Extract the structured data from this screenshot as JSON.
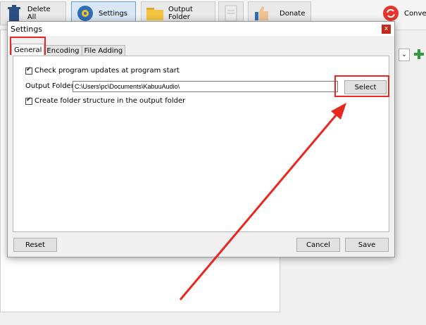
{
  "toolbar": {
    "delete_all_label": "Delete All",
    "settings_label": "Settings",
    "output_folder_label": "Output Folder",
    "donate_label": "Donate",
    "convert_label": "Conve"
  },
  "dialog": {
    "title": "Settings",
    "close_glyph": "x",
    "tabs": [
      {
        "label": "General",
        "active": true
      },
      {
        "label": "Encoding",
        "active": false
      },
      {
        "label": "File Adding",
        "active": false
      }
    ],
    "general": {
      "check_updates_label": "Check program updates at program start",
      "check_updates_checked": true,
      "output_folder_label": "Output Folder:",
      "output_folder_value": "C:\\Users\\pc\\Documents\\KabuuAudio\\",
      "select_button_label": "Select",
      "create_structure_label": "Create folder structure in the output folder",
      "create_structure_checked": true
    },
    "reset_label": "Reset",
    "cancel_label": "Cancel",
    "save_label": "Save"
  },
  "colors": {
    "annotation": "#e8271f",
    "close_button": "#c42b1c",
    "add_green": "#2e9b3a"
  }
}
